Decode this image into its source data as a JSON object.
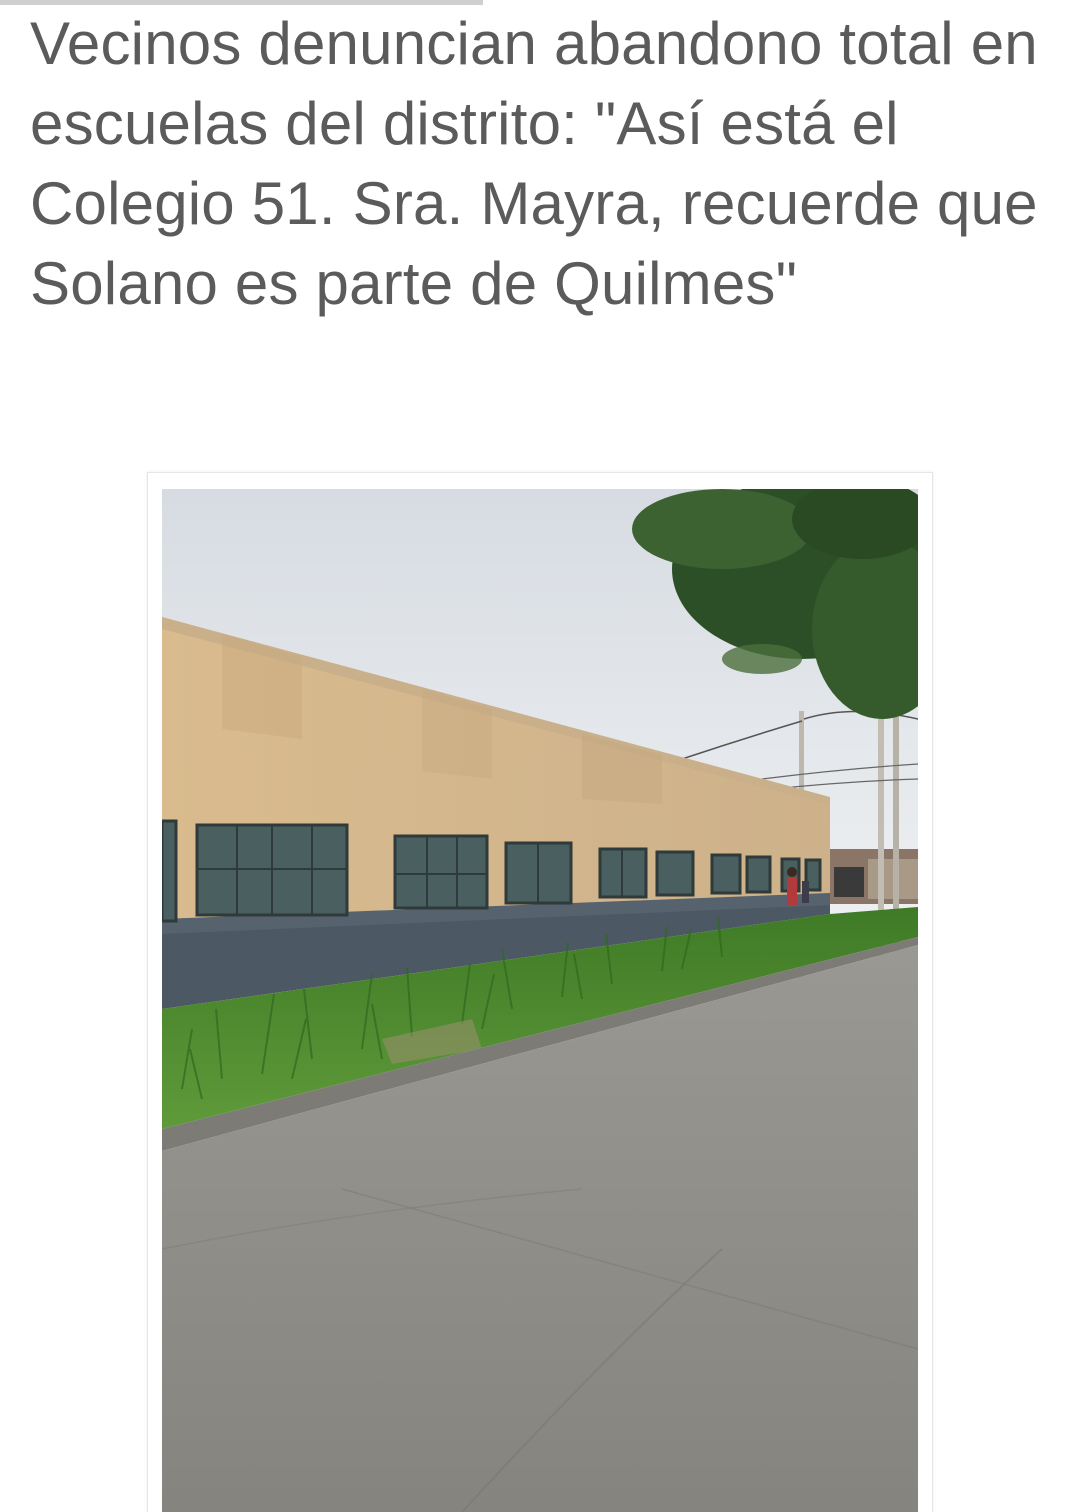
{
  "article": {
    "headline": "Vecinos denuncian abandono total en escuelas del distrito: \"Así está el Colegio 51. Sra. Mayra, recuerde que Solano es parte de Quilmes\""
  },
  "colors": {
    "headline_text": "#5b5b5b",
    "background": "#ffffff",
    "divider": "#cfcfcf",
    "wall_upper": "#d6b98c",
    "wall_lower": "#4f5b66",
    "grass": "#4f8a2c",
    "road": "#8d8c88",
    "sky": "#e4e7eb"
  },
  "photo": {
    "type": "photograph",
    "subject": "school-building-street-view"
  }
}
